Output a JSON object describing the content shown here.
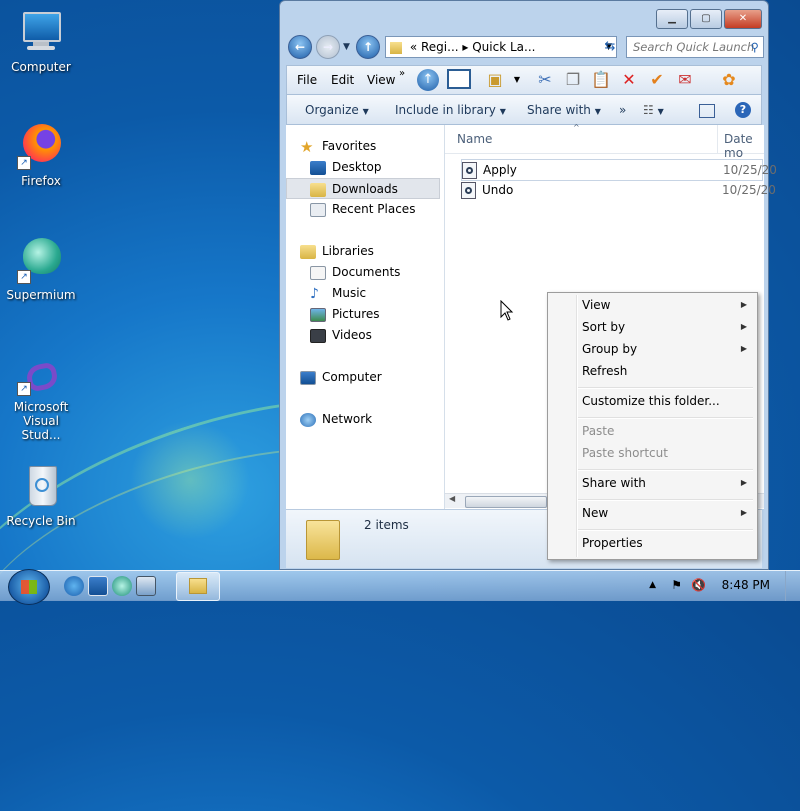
{
  "desktop": {
    "icons": [
      {
        "label": "Computer"
      },
      {
        "label": "Firefox"
      },
      {
        "label": "Supermium"
      },
      {
        "label": "Microsoft Visual Stud..."
      },
      {
        "label": "Recycle Bin"
      }
    ]
  },
  "window": {
    "address": {
      "prefix": "«",
      "path": "Regi...  ▸  Quick La..."
    },
    "search": {
      "placeholder": "Search Quick Launch"
    },
    "menu": {
      "file": "File",
      "edit": "Edit",
      "view": "View",
      "more": "»"
    },
    "commands": {
      "organize": "Organize",
      "include": "Include in library",
      "share": "Share with",
      "more": "»"
    },
    "nav_pane": {
      "favorites": "Favorites",
      "desktop": "Desktop",
      "downloads": "Downloads",
      "recent": "Recent Places",
      "libraries": "Libraries",
      "documents": "Documents",
      "music": "Music",
      "pictures": "Pictures",
      "videos": "Videos",
      "computer": "Computer",
      "network": "Network"
    },
    "columns": {
      "name": "Name",
      "date": "Date mo"
    },
    "files": [
      {
        "name": "Apply",
        "date": "10/25/20"
      },
      {
        "name": "Undo",
        "date": "10/25/20"
      }
    ],
    "details": {
      "count": "2 items"
    }
  },
  "context_menu": {
    "view": "View",
    "sort_by": "Sort by",
    "group_by": "Group by",
    "refresh": "Refresh",
    "customize": "Customize this folder...",
    "paste": "Paste",
    "paste_shortcut": "Paste shortcut",
    "share_with": "Share with",
    "new": "New",
    "properties": "Properties"
  },
  "taskbar": {
    "clock": "8:48 PM"
  }
}
